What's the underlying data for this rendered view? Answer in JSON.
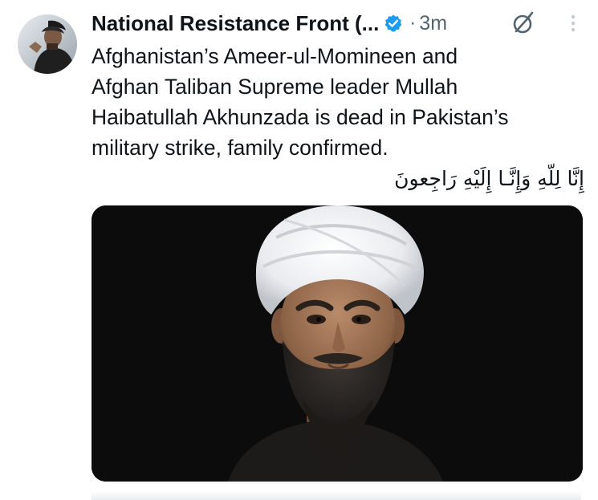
{
  "post": {
    "author": {
      "display_name": "National Resistance Front (...",
      "verified": true,
      "verified_color": "#1d9bf0",
      "avatar_icon": "profile-photo"
    },
    "separator": "·",
    "time_ago": "3m",
    "actions": {
      "grok_icon": "grok-slash-circle-icon",
      "more_icon": "vertical-dots-icon"
    },
    "text_lines": [
      "Afghanistan’s Ameer-ul-Momineen and",
      "Afghan Taliban Supreme leader Mullah",
      "Haibatullah Akhunzada is dead in Pakistan’s",
      "military strike, family confirmed."
    ],
    "arabic_line": "إِنَّا لِلّهِ وَإِنَّـا إِلَيْهِ رَاجِعونَ",
    "media": {
      "kind": "portrait photo",
      "background_color": "#0c0c0c"
    }
  },
  "colors": {
    "text_primary": "#0f1419",
    "text_secondary": "#536471",
    "accent": "#1d9bf0"
  }
}
